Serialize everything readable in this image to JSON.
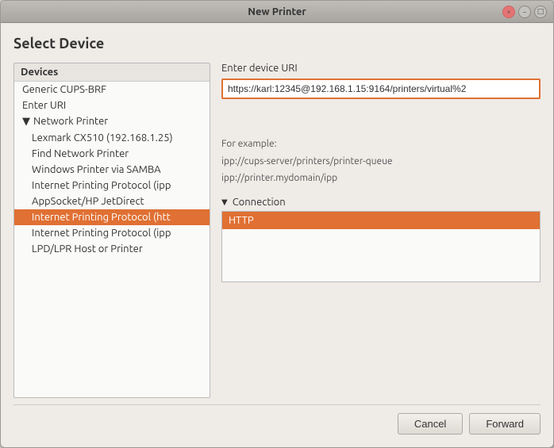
{
  "window": {
    "title": "New Printer",
    "buttons": {
      "close": "×",
      "minimize": "−",
      "maximize": "□"
    }
  },
  "page": {
    "title": "Select Device"
  },
  "left_panel": {
    "header": "Devices",
    "items": [
      {
        "id": "generic-cups-brf",
        "label": "Generic CUPS-BRF",
        "indent": 0,
        "selected": false
      },
      {
        "id": "enter-uri",
        "label": "Enter URI",
        "indent": 0,
        "selected": false
      },
      {
        "id": "network-printer",
        "label": "Network Printer",
        "indent": 0,
        "selected": false,
        "arrow": "▼"
      },
      {
        "id": "lexmark-cx510",
        "label": "Lexmark CX510 (192.168.1.25)",
        "indent": 1,
        "selected": false
      },
      {
        "id": "find-network-printer",
        "label": "Find Network Printer",
        "indent": 1,
        "selected": false
      },
      {
        "id": "windows-printer-samba",
        "label": "Windows Printer via SAMBA",
        "indent": 1,
        "selected": false
      },
      {
        "id": "ipp-1",
        "label": "Internet Printing Protocol (ipp",
        "indent": 1,
        "selected": false
      },
      {
        "id": "appSocket",
        "label": "AppSocket/HP JetDirect",
        "indent": 1,
        "selected": false
      },
      {
        "id": "ipp-http",
        "label": "Internet Printing Protocol (htt",
        "indent": 1,
        "selected": true
      },
      {
        "id": "ipp-2",
        "label": "Internet Printing Protocol (ipp",
        "indent": 1,
        "selected": false
      },
      {
        "id": "lpd-lpr",
        "label": "LPD/LPR Host or Printer",
        "indent": 1,
        "selected": false
      }
    ]
  },
  "right_panel": {
    "uri_label": "Enter device URI",
    "uri_value": "https://karl:12345@192.168.1.15:9164/printers/virtual%2",
    "uri_placeholder": "https://karl:12345@192.168.1.15:9164/printers/virtual%2",
    "example_label": "For example:",
    "example_lines": [
      "ipp://cups-server/printers/printer-queue",
      "ipp://printer.mydomain/ipp"
    ],
    "connection_label": "Connection",
    "connection_items": [
      {
        "id": "http",
        "label": "HTTP",
        "selected": true
      }
    ]
  },
  "buttons": {
    "cancel": "Cancel",
    "forward": "Forward"
  }
}
